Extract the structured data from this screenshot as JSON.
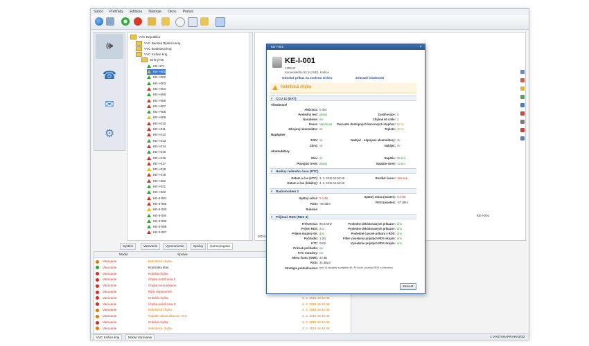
{
  "menu": [
    "Súbor",
    "Prehľady",
    "Editácia",
    "Nástroje",
    "Okno",
    "Pomoc"
  ],
  "tree": {
    "root": "VVC Republika",
    "items": [
      {
        "label": "VVC Banská Bystrica kraj",
        "level": 1,
        "type": "folder"
      },
      {
        "label": "VVC Bratislava kraj",
        "level": 1,
        "type": "folder"
      },
      {
        "label": "VVC Košice kraj",
        "level": 1,
        "type": "folder"
      },
      {
        "label": "Siréný KE",
        "level": 2,
        "type": "folder"
      },
      {
        "label": "KE-HY1",
        "level": 3,
        "type": "tri",
        "color": "green"
      },
      {
        "label": "KE-I-001",
        "level": 3,
        "type": "tri",
        "color": "yellow",
        "selected": true
      },
      {
        "label": "KE-I-002",
        "level": 3,
        "type": "tri",
        "color": "green"
      },
      {
        "label": "KE-I-003",
        "level": 3,
        "type": "tri",
        "color": "green"
      },
      {
        "label": "KE-I-004",
        "level": 3,
        "type": "tri",
        "color": "red"
      },
      {
        "label": "KE-I-005",
        "level": 3,
        "type": "tri",
        "color": "green"
      },
      {
        "label": "KE-I-006",
        "level": 3,
        "type": "tri",
        "color": "red"
      },
      {
        "label": "KE-I-007",
        "level": 3,
        "type": "tri",
        "color": "red"
      },
      {
        "label": "KE-I-008",
        "level": 3,
        "type": "tri",
        "color": "green"
      },
      {
        "label": "KE-I-009",
        "level": 3,
        "type": "tri",
        "color": "yellow"
      },
      {
        "label": "KE-I-010",
        "level": 3,
        "type": "tri",
        "color": "red"
      },
      {
        "label": "KE-I-011",
        "level": 3,
        "type": "tri",
        "color": "red"
      },
      {
        "label": "KE-I-012",
        "level": 3,
        "type": "tri",
        "color": "red"
      },
      {
        "label": "KE-I-013",
        "level": 3,
        "type": "tri",
        "color": "green"
      },
      {
        "label": "KE-I-014",
        "level": 3,
        "type": "tri",
        "color": "red"
      },
      {
        "label": "KE-I-015",
        "level": 3,
        "type": "tri",
        "color": "green"
      },
      {
        "label": "KE-I-016",
        "level": 3,
        "type": "tri",
        "color": "red"
      },
      {
        "label": "KE-I-017",
        "level": 3,
        "type": "tri",
        "color": "red"
      },
      {
        "label": "KE-I-018",
        "level": 3,
        "type": "tri",
        "color": "yellow"
      },
      {
        "label": "KE-I-019",
        "level": 3,
        "type": "tri",
        "color": "red"
      },
      {
        "label": "KE-I-020",
        "level": 3,
        "type": "tri",
        "color": "red"
      },
      {
        "label": "KE-I-021",
        "level": 3,
        "type": "tri",
        "color": "green"
      },
      {
        "label": "KE-I-022",
        "level": 3,
        "type": "tri",
        "color": "green"
      },
      {
        "label": "KE-II-001",
        "level": 3,
        "type": "tri",
        "color": "red"
      },
      {
        "label": "KE-II-002",
        "level": 3,
        "type": "tri",
        "color": "red"
      },
      {
        "label": "KE-II-003",
        "level": 3,
        "type": "tri",
        "color": "yellow"
      },
      {
        "label": "KE-II-004",
        "level": 3,
        "type": "tri",
        "color": "green"
      },
      {
        "label": "KE-II-005",
        "level": 3,
        "type": "tri",
        "color": "green"
      },
      {
        "label": "KE-II-006",
        "level": 3,
        "type": "tri",
        "color": "green"
      },
      {
        "label": "KE-II-007",
        "level": 3,
        "type": "tri",
        "color": "red"
      }
    ]
  },
  "bottom_tabs": [
    "Systém",
    "Varovanie",
    "Vyrozumenie",
    "Správy",
    "Harmonogram"
  ],
  "grid": {
    "headers": [
      "Modul",
      "Správa",
      "Dátum a čas"
    ],
    "rows": [
      {
        "modul": "Varovanie",
        "sprava": "Nekritická chyba.",
        "datum": "3. 3. 2015 16:44:24",
        "color": "orange",
        "icon": "orange"
      },
      {
        "modul": "Varovanie",
        "sprava": "Normálny stav.",
        "datum": "3. 3. 2015 16:44:13",
        "color": "black",
        "icon": "green"
      },
      {
        "modul": "Varovanie",
        "sprava": "Kritická chyba.",
        "datum": "3. 3. 2015 16:44:00",
        "color": "red",
        "icon": "red"
      },
      {
        "modul": "Varovanie",
        "sprava": "Chyba pozičnosa 1.",
        "datum": "3. 3. 2015 16:44:00",
        "color": "red",
        "icon": "red"
      },
      {
        "modul": "Varovanie",
        "sprava": "Chyba komunikácie.",
        "datum": "3. 3. 2015 16:44:00",
        "color": "red",
        "icon": "red"
      },
      {
        "modul": "Varovanie",
        "sprava": "RDS nepritomné.",
        "datum": "3. 3. 2015 16:42:46",
        "color": "red",
        "icon": "red"
      },
      {
        "modul": "Varovanie",
        "sprava": "Kritická chyba.",
        "datum": "3. 3. 2015 16:42:46",
        "color": "red",
        "icon": "red"
      },
      {
        "modul": "Varovanie",
        "sprava": "Chyba pozičnosa 2.",
        "datum": "3. 3. 2015 16:42:46",
        "color": "red",
        "icon": "red"
      },
      {
        "modul": "Varovanie",
        "sprava": "Nekritická chyba.",
        "datum": "3. 3. 2015 16:42:46",
        "color": "orange",
        "icon": "orange"
      },
      {
        "modul": "Varovanie",
        "sprava": "Napätie akumulátorov: 2X3",
        "datum": "3. 3. 2015 16:42:46",
        "color": "orange",
        "icon": "orange"
      },
      {
        "modul": "Varovanie",
        "sprava": "Kritická chyba.",
        "datum": "3. 3. 2015 16:42:46",
        "color": "red",
        "icon": "red"
      },
      {
        "modul": "Varovanie",
        "sprava": "Nekritická chyba.",
        "datum": "3. 3. 2015 16:42:46",
        "color": "orange",
        "icon": "orange"
      }
    ]
  },
  "status": {
    "tab1": "VVC Košice kraj",
    "tab2": "Modul Varovanie",
    "right": "1 VVSTARAPRAHA3/10"
  },
  "dialog": {
    "title": "KE-I-001",
    "heading": "KE-I-001",
    "line1": "1200 W",
    "line2": "Komenského 53 (HJ KE), Košice",
    "link1": "Odoslať príkaz na zvolenú sirénu",
    "link2": "Zobraziť vlastnosti",
    "warning": "Nekritická chyba",
    "sections": {
      "ccu": "CCU 11 (DAT)",
      "hodiny": "Hodiny reálneho času (RTC)",
      "radio": "Radiomodem 2",
      "prijimac": "Prijímač RDS (RDS 3)"
    },
    "vseobecne": "Všeobecné",
    "napajanie": "Napájanie",
    "akumulatory": "Akumulátory",
    "f": {
      "aktivacia_l": "Aktivácia:",
      "aktivacia_v": "0 dnú",
      "posledny_l": "Posledný test:",
      "posledny_v": "platný",
      "narusenie_l": "Narušenie:",
      "narusenie_v": "nie",
      "dvere_l": "Dvere:",
      "dvere_v": "zatvorené",
      "zdroj_l": "Zdrojový akumulátor:",
      "zdroj_v": "ok",
      "zosilnovac_l": "Zosilňovače:",
      "zosilnovac_v": "4",
      "chybne_l": "Chybné 60 cmle:",
      "chybne_v": "1",
      "percento_l": "Percento dostupných koncových stupňov:",
      "percento_v": "50 %",
      "teplota_l": "Teplota:",
      "teplota_v": "30 %",
      "z230_l": "230V:",
      "z230_v": "ok",
      "zdroj2_l": "Zdroj:",
      "zdroj2_v": "ok",
      "nabijac_l": "Nabíjač - odpojené akumulátory:",
      "nabijac_v": "ok",
      "nabijac2_l": "Nabíjač:",
      "nabijac2_v": "ok",
      "stav_l": "Stav:",
      "stav_v": "ok",
      "plavat_l": "Plávajúci tresk:",
      "plavat_v": "platný",
      "napatie_l": "Napätie:",
      "napatie_v": "25,6 V",
      "prud_l": "Napätie stred:",
      "prud_v": "12,8 V",
      "datum_utc_l": "Dátum a čas (UTC):",
      "datum_utc_v": "3. 3. 2015 15:52:48",
      "datum_loc_l": "Dátum a čas (lokálny):",
      "datum_loc_v": "3. 3. 2015 16:52:48",
      "rozdiel_l": "Rozdiel časov:",
      "rozdiel_v": "194 sek.",
      "spatny_l": "Spätný odraz:",
      "spatny_v": "5,0 dB",
      "rssi_l": "RSSI:",
      "rssi_v": "-60 dBm",
      "rusenie_l": "Rušenie:",
      "rusenie_v": "",
      "spatny2_l": "Spätný odraz (master):",
      "spatny2_v": "5,9 dB",
      "rssi2_l": "RSSI (master):",
      "rssi2_v": "-67 dBm",
      "frekvencia_l": "Frekvencia:",
      "frekvencia_v": "96,6 MHz",
      "prijem_l": "Príjem RDS:",
      "prijem_v": "áno",
      "skupina_l": "Príjem skupiny 9A:",
      "skupina_v": "áno",
      "pocitadlo_l": "Počítadlo:",
      "pocitadlo_v": "1 (E)",
      "ktc_l": "KTC:",
      "ktc_v": "0x02",
      "priznak_l": "Príznak počítadla:",
      "priznak_v": "nie",
      "ktc_nez_l": "KTC neznámy:",
      "ktc_nez_v": "nie",
      "miera_l": "Miera šumu (SNR):",
      "miera_v": "23 dB",
      "rssi3_l": "RSSI:",
      "rssi3_v": "34 dBµV",
      "posl_dek_l": "Posledne dekódovaných príkazov:",
      "posl_dek_v": "áno",
      "posl_dek2_l": "Posledne dekódovaných príkazov:",
      "posl_dek2_v": "áno",
      "posl_cas_l": "Posledné časové príkazy v RDS:",
      "posl_cas_v": "áno",
      "filter_l": "Filter vysielania prijatých RDS skupín:",
      "filter_v": "áno",
      "vysiel_l": "Vysielanie prijatých RDS skupín:",
      "vysiel_v": "áno",
      "strategia_l": "Stratégia prebudovania:",
      "strategia_v": "test 14 skupiny a prijatím 3A, PI kódu, príznku RDS a frekvencí"
    },
    "ok": "Zatvoriť"
  },
  "right_pane": {
    "caption": "KE-I-001",
    "scale": "200 m"
  }
}
